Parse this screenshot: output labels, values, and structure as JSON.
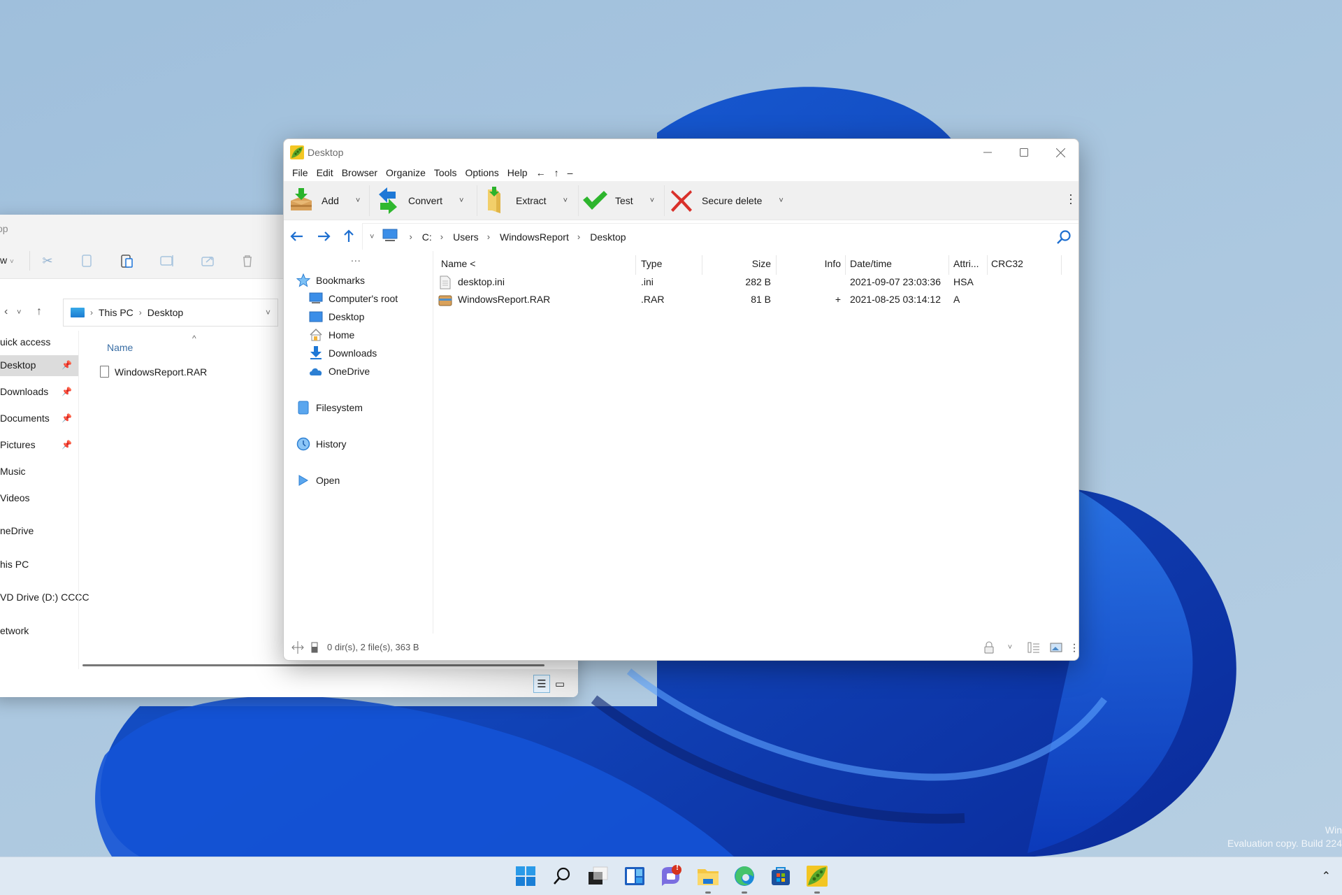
{
  "desktop": {
    "watermark_line1": "Win",
    "watermark_line2": "Evaluation copy. Build 224"
  },
  "explorer": {
    "title_fragment": "op",
    "new_button": "w",
    "toolbar_icons": [
      "cut-icon",
      "copy-icon",
      "paste-icon",
      "rename-icon",
      "share-icon",
      "delete-icon"
    ],
    "breadcrumb": [
      "This PC",
      "Desktop"
    ],
    "nav_items": [
      {
        "label": "uick access",
        "pinned": false,
        "selected": false
      },
      {
        "label": "Desktop",
        "pinned": true,
        "selected": true
      },
      {
        "label": "Downloads",
        "pinned": true,
        "selected": false
      },
      {
        "label": "Documents",
        "pinned": true,
        "selected": false
      },
      {
        "label": "Pictures",
        "pinned": true,
        "selected": false
      },
      {
        "label": "Music",
        "pinned": false,
        "selected": false
      },
      {
        "label": "Videos",
        "pinned": false,
        "selected": false
      },
      {
        "label": "neDrive",
        "pinned": false,
        "selected": false
      },
      {
        "label": "his PC",
        "pinned": false,
        "selected": false
      },
      {
        "label": "VD Drive (D:) CCCC",
        "pinned": false,
        "selected": false
      },
      {
        "label": "etwork",
        "pinned": false,
        "selected": false
      }
    ],
    "column_name": "Name",
    "files": [
      "WindowsReport.RAR"
    ]
  },
  "peazip": {
    "title": "Desktop",
    "menu": [
      "File",
      "Edit",
      "Browser",
      "Organize",
      "Tools",
      "Options",
      "Help",
      "←",
      "↑",
      "–"
    ],
    "toolbar": [
      {
        "label": "Add",
        "icon": "add-archive-icon"
      },
      {
        "label": "Convert",
        "icon": "convert-icon"
      },
      {
        "label": "Extract",
        "icon": "extract-icon"
      },
      {
        "label": "Test",
        "icon": "test-check-icon"
      },
      {
        "label": "Secure delete",
        "icon": "secure-delete-icon"
      }
    ],
    "address": [
      "C:",
      "Users",
      "WindowsReport",
      "Desktop"
    ],
    "sidebar": {
      "more": "...",
      "bookmarks_label": "Bookmarks",
      "bookmarks": [
        "Computer's root",
        "Desktop",
        "Home",
        "Downloads",
        "OneDrive"
      ],
      "filesystem": "Filesystem",
      "history": "History",
      "open": "Open"
    },
    "columns": [
      "Name <",
      "Type",
      "Size",
      "Info",
      "Date/time",
      "Attri...",
      "CRC32"
    ],
    "files": [
      {
        "name": "desktop.ini",
        "type": ".ini",
        "size": "282 B",
        "info": "",
        "datetime": "2021-09-07 23:03:36",
        "attributes": "HSA",
        "crc32": ""
      },
      {
        "name": "WindowsReport.RAR",
        "type": ".RAR",
        "size": "81 B",
        "info": "+",
        "datetime": "2021-08-25 03:14:12",
        "attributes": "A",
        "crc32": ""
      }
    ],
    "status": "0 dir(s), 2 file(s), 363 B"
  },
  "taskbar": {
    "apps": [
      "start",
      "search",
      "task-view",
      "widgets",
      "chat",
      "file-explorer",
      "edge",
      "store",
      "peazip"
    ],
    "chat_badge": "!"
  }
}
